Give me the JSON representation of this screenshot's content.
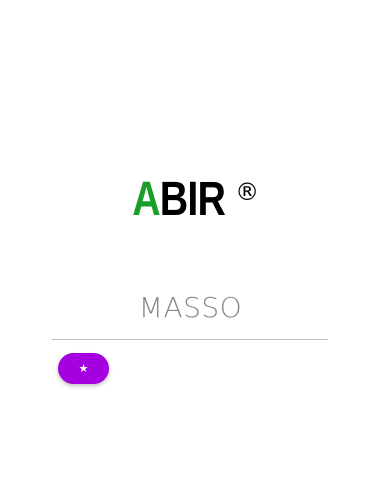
{
  "logo": {
    "first_letter": "A",
    "rest": "BIR",
    "registered_mark": "®"
  },
  "brand": {
    "name": "MASSO"
  },
  "fab": {
    "icon": "star-icon",
    "glyph": "★",
    "color": "#a500e0"
  },
  "colors": {
    "logo_accent": "#1a9e2a",
    "brand_text": "#888888"
  }
}
